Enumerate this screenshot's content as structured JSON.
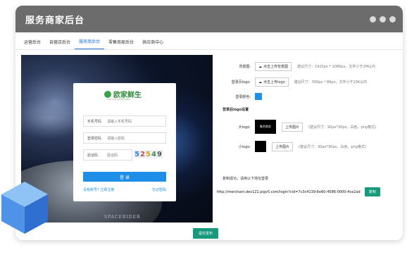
{
  "header": {
    "title": "服务商家后台"
  },
  "tabs": [
    "运营后台",
    "自营店后台",
    "服务商后台",
    "零售商家后台",
    "供应商中心"
  ],
  "active_tab_index": 2,
  "preview": {
    "background_caption": "SPACERIDER",
    "login": {
      "brand_name": "欧家鲜生",
      "brand_sub": "OUJIAXIANSHENG",
      "fields": [
        {
          "label": "手机号码",
          "placeholder": "请输入手机号码"
        },
        {
          "label": "登录密码",
          "placeholder": "请输入密码"
        },
        {
          "label": "验证码",
          "placeholder": "验证码"
        }
      ],
      "captcha": [
        "5",
        "2",
        "5",
        "4",
        "9"
      ],
      "login_button": "登 录",
      "register_link": "没有账号? 立即注册",
      "forgot_link": "忘记密码"
    }
  },
  "settings": {
    "background": {
      "label": "背景图:",
      "button": "点击上传背景图",
      "hint": "建议尺寸：1920px * 1080px，文件小于2M以内"
    },
    "login_logo": {
      "label": "登录页logo:",
      "button": "点击上传logo",
      "hint": "建议尺寸：300px * 86px，文件小于10K以内"
    },
    "theme_color": {
      "label": "登录颜色:",
      "color": "#1f8ee6"
    },
    "section_title": "登录后logo设置",
    "large_logo": {
      "label": "大logo:",
      "thumb_text": "聚合商务",
      "button": "上传图片",
      "hint": "(建议尺寸：90px*30px，白色，png格式)"
    },
    "small_logo": {
      "label": "小logo:",
      "button": "上传图片",
      "hint": "(建议尺寸：30px*30px，白色，png格式)"
    },
    "copy_notice": "复制成功，请用以下地址登录",
    "login_url": "http://merchant.dev122.pigv5.com/login?cid=7c3c4139-6e60-4586-0000-4ce2ad",
    "copy_button": "复制",
    "submit_button": "提交发布"
  },
  "colors": {
    "primary": "#1f8ee6",
    "accent": "#17997d",
    "titlebar": "#6c6c6c"
  }
}
